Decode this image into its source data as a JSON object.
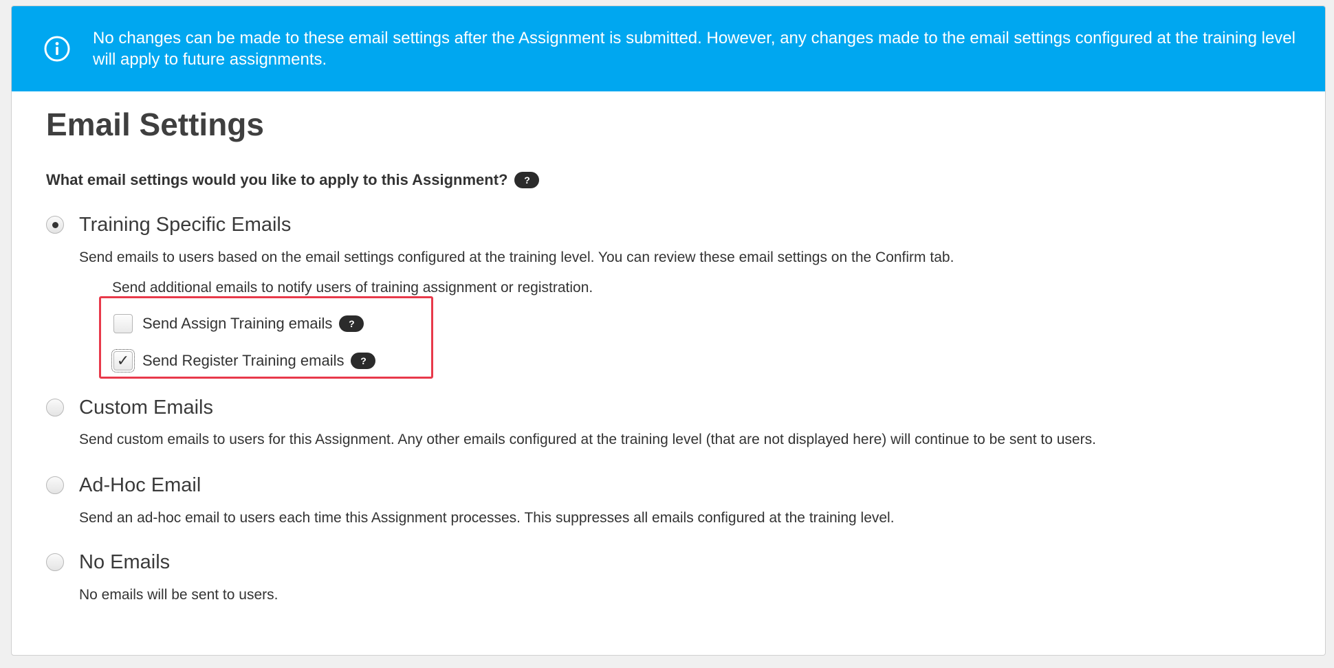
{
  "banner": {
    "icon": "info-circle-icon",
    "text": "No changes can be made to these email settings after the Assignment is submitted. However, any changes made to the email settings configured at the training level will apply to future assignments.",
    "color": "#00a7f0"
  },
  "page": {
    "title": "Email Settings",
    "question": "What email settings would you like to apply to this Assignment?",
    "help_symbol": "?"
  },
  "options": [
    {
      "label": "Training Specific Emails",
      "selected": true,
      "description": "Send emails to users based on the email settings configured at the training level. You can review these email settings on the Confirm tab."
    },
    {
      "label": "Custom Emails",
      "selected": false,
      "description": "Send custom emails to users for this Assignment. Any other emails configured at the training level (that are not displayed here) will continue to be sent to users."
    },
    {
      "label": "Ad-Hoc Email",
      "selected": false,
      "description": "Send an ad-hoc email to users each time this Assignment processes. This suppresses all emails configured at the training level."
    },
    {
      "label": "No Emails",
      "selected": false,
      "description": "No emails will be sent to users."
    }
  ],
  "training_specific": {
    "subnote": "Send additional emails to notify users of training assignment or registration.",
    "checkboxes": [
      {
        "label": "Send Assign Training emails",
        "checked": false
      },
      {
        "label": "Send Register Training emails",
        "checked": true
      }
    ],
    "check_glyph": "✓",
    "highlight_color": "#e8394a"
  }
}
